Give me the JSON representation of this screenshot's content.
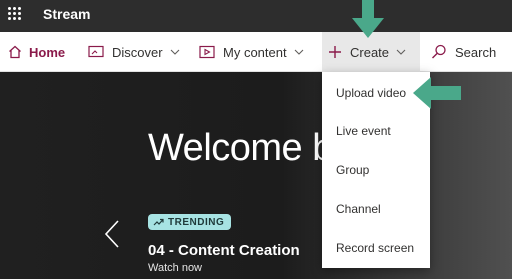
{
  "app": {
    "title": "Stream",
    "launcher_icon": "waffle-icon"
  },
  "nav": {
    "items": [
      {
        "label": "Home",
        "icon": "home-icon"
      },
      {
        "label": "Discover",
        "icon": "discover-icon"
      },
      {
        "label": "My content",
        "icon": "play-icon"
      },
      {
        "label": "Create",
        "icon": "plus-icon"
      },
      {
        "label": "Search",
        "icon": "search-icon"
      }
    ],
    "colors": {
      "accent": "#8a1a4a",
      "active_bg": "#e8e8e8"
    }
  },
  "hero": {
    "welcome": "Welcome bac",
    "badge": "TRENDING",
    "video_title": "04 - Content Creation",
    "watch_label": "Watch now",
    "badge_color": "#a7e3e3"
  },
  "create_menu": {
    "items": [
      "Upload video",
      "Live event",
      "Group",
      "Channel",
      "Record screen"
    ]
  },
  "annotation": {
    "arrow_color": "#4aa88a"
  }
}
